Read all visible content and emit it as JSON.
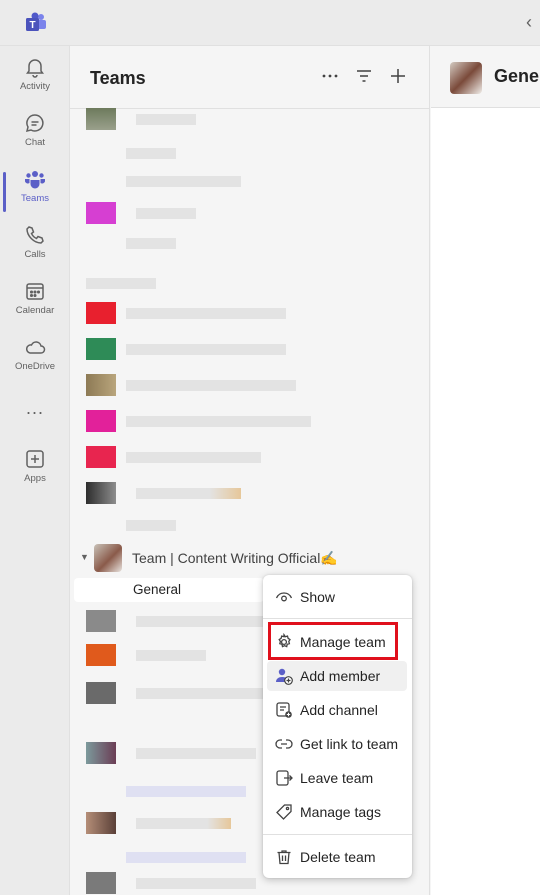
{
  "nav": {
    "items": [
      {
        "label": "Activity",
        "icon": "bell-icon"
      },
      {
        "label": "Chat",
        "icon": "chat-icon"
      },
      {
        "label": "Teams",
        "icon": "teams-icon"
      },
      {
        "label": "Calls",
        "icon": "phone-icon"
      },
      {
        "label": "Calendar",
        "icon": "calendar-icon"
      },
      {
        "label": "OneDrive",
        "icon": "cloud-icon"
      },
      {
        "label": "Apps",
        "icon": "add-app-icon"
      }
    ],
    "more": "...",
    "active": "Teams"
  },
  "panel": {
    "title": "Teams",
    "team": {
      "name": "Team | Content Writing Official✍️",
      "channel": "General"
    }
  },
  "main": {
    "title": "General"
  },
  "menu": {
    "items": [
      {
        "label": "Show",
        "icon": "eye-icon"
      },
      {
        "label": "Manage team",
        "icon": "gear-icon"
      },
      {
        "label": "Add member",
        "icon": "add-person-icon"
      },
      {
        "label": "Add channel",
        "icon": "add-channel-icon"
      },
      {
        "label": "Get link to team",
        "icon": "link-icon"
      },
      {
        "label": "Leave team",
        "icon": "leave-icon"
      },
      {
        "label": "Manage tags",
        "icon": "tag-icon"
      },
      {
        "label": "Delete team",
        "icon": "trash-icon"
      }
    ],
    "highlighted": "Manage team"
  },
  "colors": {
    "accent": "#5b5fc7",
    "highlight": "#e0101c"
  }
}
